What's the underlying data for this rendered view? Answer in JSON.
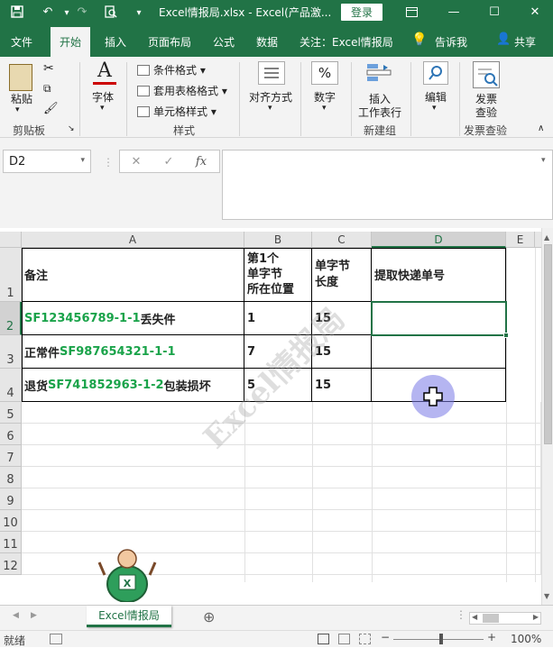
{
  "titlebar": {
    "title": "Excel情报局.xlsx  -  Excel(产品激...",
    "login_label": "登录",
    "save_icon": "💾",
    "undo_icon": "↶",
    "redo_icon": "↷",
    "preview_icon": "🔍",
    "qat_icon": "▾"
  },
  "window_controls": {
    "restore_icon": "⧉",
    "min_icon": "—",
    "max_icon": "☐",
    "close_icon": "✕"
  },
  "menu": {
    "file": "文件",
    "home": "开始",
    "insert": "插入",
    "layout": "页面布局",
    "formula": "公式",
    "data": "数据",
    "follow": "关注：Excel情报局",
    "tell": "告诉我",
    "share": "共享"
  },
  "ribbon": {
    "paste": "粘贴",
    "clipboard": "剪贴板",
    "font": "字体",
    "cond_format": "条件格式 ▾",
    "table_format": "套用表格格式 ▾",
    "cell_style": "单元格样式 ▾",
    "styles": "样式",
    "align": "对齐方式",
    "number": "数字",
    "insert_wf1": "插入",
    "insert_wf2": "工作表行",
    "new_group": "新建组",
    "edit": "编辑",
    "invoice1": "发票",
    "invoice2": "查验",
    "invoice_group": "发票查验",
    "number_icon": "%",
    "font_icon": "A"
  },
  "formula_bar": {
    "name_box": "D2",
    "cancel": "✕",
    "enter": "✓",
    "fx": "fx",
    "value": ""
  },
  "columns": [
    "A",
    "B",
    "C",
    "D",
    "E"
  ],
  "rows": [
    "1",
    "2",
    "3",
    "4",
    "5",
    "6",
    "7",
    "8",
    "9",
    "10",
    "11",
    "12"
  ],
  "header_row": {
    "a": "备注",
    "b": "第1个\n单字节\n所在位置",
    "c": "单字节\n长度",
    "d": "提取快递单号"
  },
  "data_rows": [
    {
      "a_pre": "",
      "a_green": "SF123456789-1-1",
      "a_post": "丢失件",
      "b": "1",
      "c": "15"
    },
    {
      "a_pre": "正常件",
      "a_green": "SF987654321-1-1",
      "a_post": "",
      "b": "7",
      "c": "15"
    },
    {
      "a_pre": "退货",
      "a_green": "SF741852963-1-2",
      "a_post": "包装损坏",
      "b": "5",
      "c": "15"
    }
  ],
  "watermark": "Excel情报局",
  "sheet_tab": "Excel情报局",
  "add_sheet": "⊕",
  "status": {
    "ready": "就绪",
    "zoom": "100%",
    "minus": "−",
    "plus": "+"
  },
  "colors": {
    "excel_green": "#217346",
    "text_green": "#1aa34a"
  }
}
